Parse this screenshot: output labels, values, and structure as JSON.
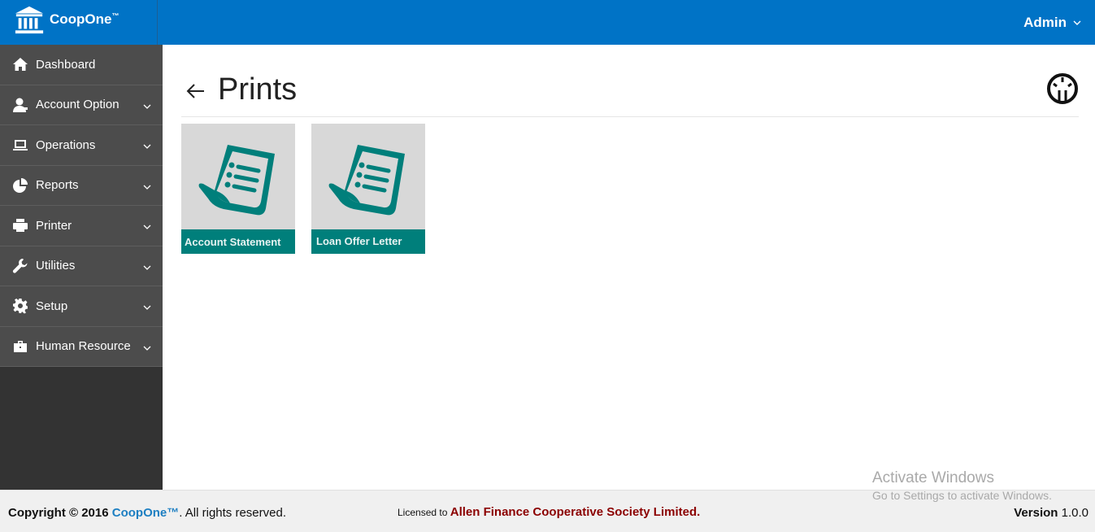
{
  "app": {
    "brand_name": "CoopOne",
    "brand_tm": "™",
    "user_label": "Admin"
  },
  "sidebar": {
    "items": [
      {
        "label": "Dashboard",
        "icon": "home-icon",
        "has_submenu": false
      },
      {
        "label": "Account Option",
        "icon": "user-icon",
        "has_submenu": true
      },
      {
        "label": "Operations",
        "icon": "laptop-icon",
        "has_submenu": true
      },
      {
        "label": "Reports",
        "icon": "pie-chart-icon",
        "has_submenu": true
      },
      {
        "label": "Printer",
        "icon": "printer-icon",
        "has_submenu": true
      },
      {
        "label": "Utilities",
        "icon": "wrench-icon",
        "has_submenu": true
      },
      {
        "label": "Setup",
        "icon": "gear-icon",
        "has_submenu": true
      },
      {
        "label": "Human Resource",
        "icon": "briefcase-icon",
        "has_submenu": true
      }
    ]
  },
  "main": {
    "title": "Prints",
    "tiles": [
      {
        "label": "Account Statement",
        "icon": "receipt-icon"
      },
      {
        "label": "Loan Offer Letter",
        "icon": "receipt-icon"
      }
    ]
  },
  "footer": {
    "copyright_prefix": "Copyright © 2016",
    "copyright_brand": "CoopOne™",
    "copyright_suffix": ". All rights reserved.",
    "licensed_prefix": "Licensed to",
    "licensed_org": "Allen Finance Cooperative Society Limited",
    "licensed_suffix": ".",
    "version_label": "Version",
    "version_value": "1.0.0"
  },
  "watermark": {
    "line1": "Activate Windows",
    "line2": "Go to Settings to activate Windows."
  },
  "colors": {
    "topbar": "#0073c6",
    "sidebar": "#4c4c4c",
    "tile_accent": "#007f7b",
    "org_text": "#8b0000"
  }
}
